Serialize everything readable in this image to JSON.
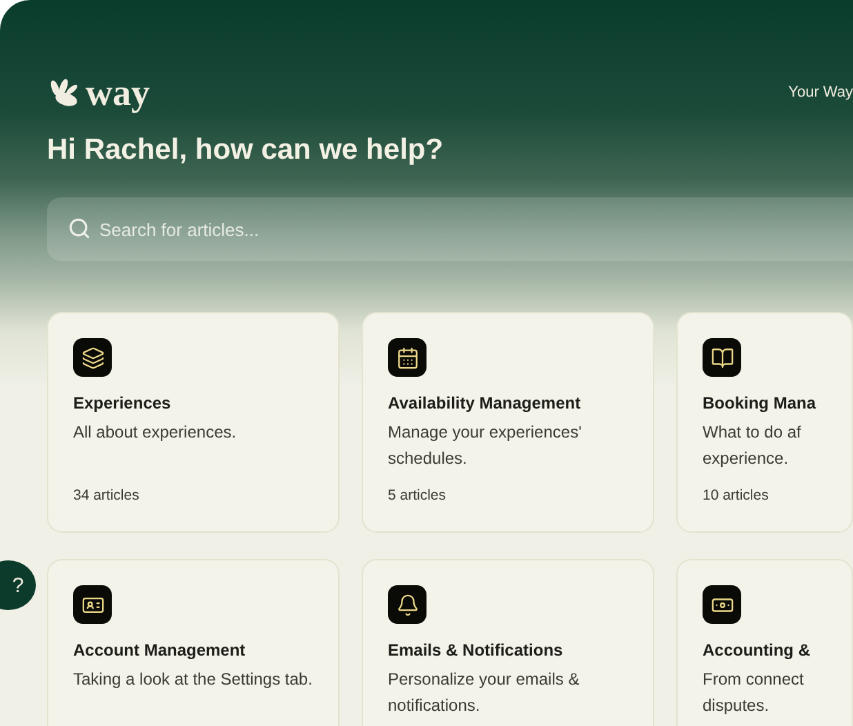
{
  "header": {
    "logo_text": "way",
    "nav_link": "Your Way"
  },
  "greeting": "Hi Rachel, how can we help?",
  "search": {
    "placeholder": "Search for articles..."
  },
  "help_button": {
    "label": "?"
  },
  "cards": [
    {
      "title": "Experiences",
      "description": [
        "All about experiences."
      ],
      "count": "34 articles"
    },
    {
      "title": "Availability Management",
      "description": [
        "Manage your experiences'",
        "schedules."
      ],
      "count": "5 articles"
    },
    {
      "title": "Booking Mana",
      "description": [
        "What to do af",
        "experience."
      ],
      "count": "10 articles"
    },
    {
      "title": "Account Management",
      "description": [
        "Taking a look at the Settings tab."
      ]
    },
    {
      "title": "Emails & Notifications",
      "description": [
        "Personalize your emails &",
        "notifications."
      ]
    },
    {
      "title": "Accounting &",
      "description": [
        "From connect",
        "disputes."
      ]
    }
  ]
}
